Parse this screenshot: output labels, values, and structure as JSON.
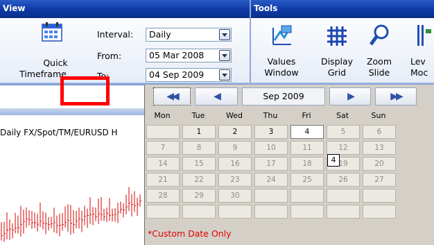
{
  "ribbon": {
    "view_title": "View",
    "tools_title": "Tools",
    "quick_timeframe": [
      "Quick",
      "Timeframe"
    ],
    "interval_label": "Interval:",
    "interval_value": "Daily",
    "from_label": "From:",
    "from_value": "05 Mar 2008",
    "to_label": "To:",
    "to_value": "04 Sep 2009",
    "tools": [
      {
        "line1": "Values",
        "line2": "Window",
        "icon": "values-window-icon"
      },
      {
        "line1": "Display",
        "line2": "Grid",
        "icon": "grid-icon"
      },
      {
        "line1": "Zoom",
        "line2": "Slide",
        "icon": "zoom-icon"
      },
      {
        "line1": "Lev",
        "line2": "Moc",
        "icon": "levels-icon"
      }
    ]
  },
  "chart": {
    "title": "Daily FX/Spot/TM/EURUSD  H"
  },
  "calendar": {
    "month": "Sep 2009",
    "prev_year_glyph": "◀◀",
    "prev_month_glyph": "◀",
    "next_month_glyph": "▶",
    "next_year_glyph": "▶▶",
    "weekdays": [
      "Mon",
      "Tue",
      "Wed",
      "Thu",
      "Fri",
      "Sat",
      "Sun"
    ],
    "weeks": [
      [
        "",
        "1",
        "2",
        "3",
        "4",
        "5",
        "6"
      ],
      [
        "7",
        "8",
        "9",
        "10",
        "11",
        "12",
        "13"
      ],
      [
        "14",
        "15",
        "16",
        "17",
        "18",
        "19",
        "20"
      ],
      [
        "21",
        "22",
        "23",
        "24",
        "25",
        "26",
        "27"
      ],
      [
        "28",
        "29",
        "30",
        "",
        "",
        "",
        ""
      ],
      [
        "",
        "",
        "",
        "",
        "",
        "",
        ""
      ]
    ],
    "enabled_days": [
      "1",
      "2",
      "3",
      "4"
    ],
    "selected_day": "4",
    "tooltip": "4",
    "footer": "*Custom Date Only"
  },
  "colors": {
    "header_blue": "#0e3aa6",
    "highlight_red": "#ff0000",
    "footer_red": "#e00000",
    "chart_red": "#d40000"
  }
}
